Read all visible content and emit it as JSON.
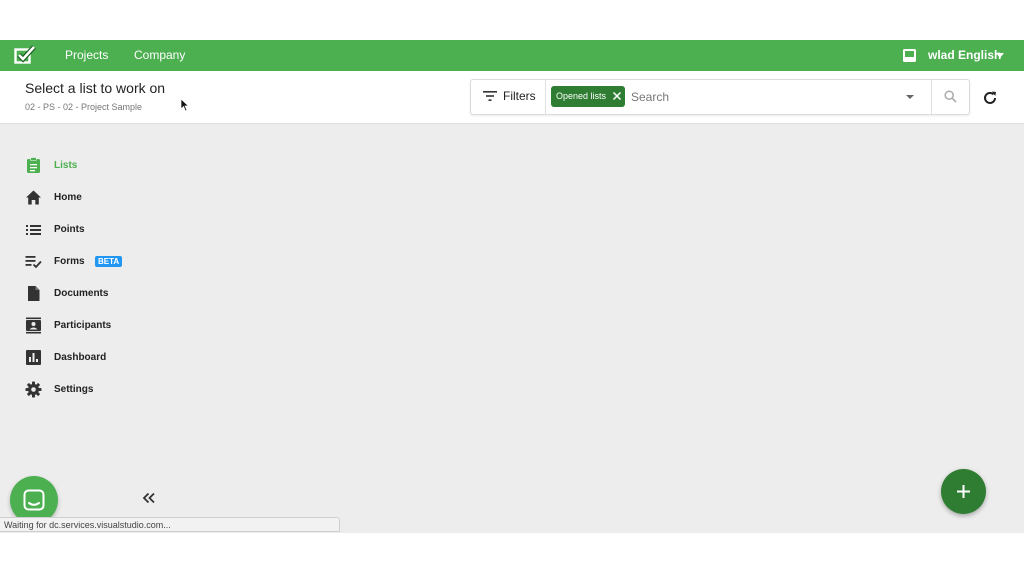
{
  "colors": {
    "brand": "#4caf50",
    "brand_dark": "#2e7d32",
    "beta_badge": "#2196f3",
    "content_bg": "#ededed"
  },
  "navbar": {
    "logo_icon": "checklist-logo-icon",
    "links": [
      "Projects",
      "Company"
    ],
    "inbox_icon": "inbox-icon",
    "user_name": "wlad English"
  },
  "subheader": {
    "title": "Select a list to work on",
    "breadcrumb": "02 - PS - 02 - Project Sample"
  },
  "search": {
    "filters_label": "Filters",
    "chip_label": "Opened lists",
    "placeholder": "Search",
    "value": ""
  },
  "sidebar": {
    "items": [
      {
        "label": "Lists",
        "icon": "clipboard-icon",
        "active": true
      },
      {
        "label": "Home",
        "icon": "home-icon"
      },
      {
        "label": "Points",
        "icon": "list-icon"
      },
      {
        "label": "Forms",
        "icon": "checklist-icon",
        "badge": "BETA"
      },
      {
        "label": "Documents",
        "icon": "document-icon"
      },
      {
        "label": "Participants",
        "icon": "contact-icon"
      },
      {
        "label": "Dashboard",
        "icon": "chart-icon"
      },
      {
        "label": "Settings",
        "icon": "gear-icon"
      }
    ]
  },
  "status_bar": {
    "text": "Waiting for dc.services.visualstudio.com..."
  }
}
